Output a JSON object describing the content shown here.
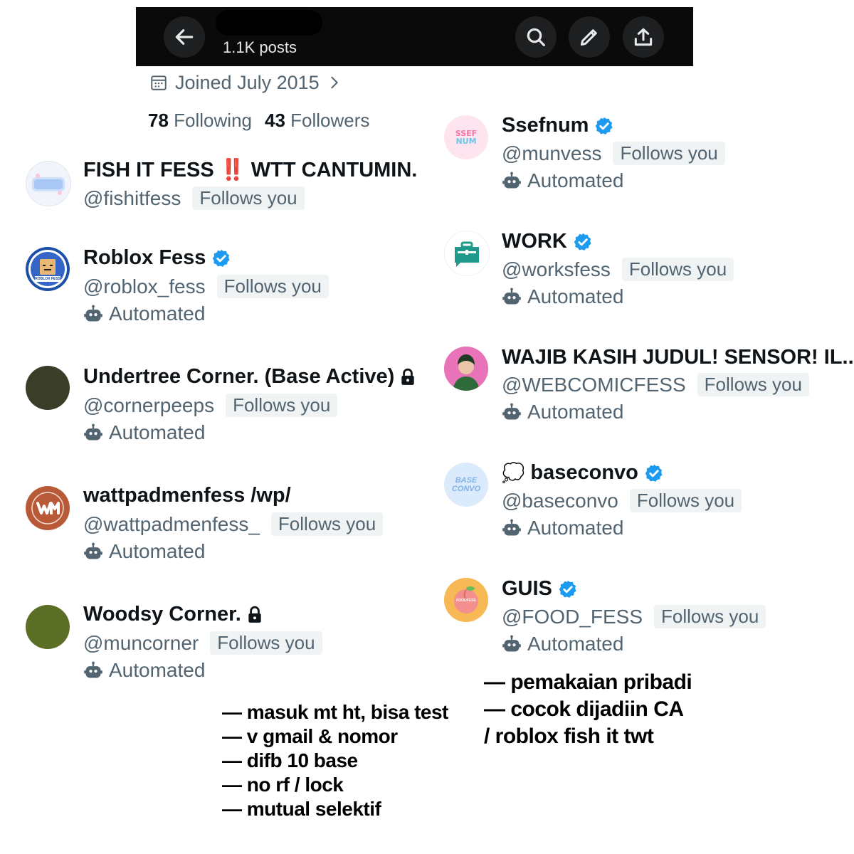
{
  "header": {
    "posts_count": "1.1K posts",
    "icons": [
      "back-arrow-icon",
      "search-icon",
      "edit-pencil-icon",
      "share-upload-icon"
    ]
  },
  "profile": {
    "joined": "Joined July 2015",
    "following_count": "78",
    "following_label": "Following",
    "followers_count": "43",
    "followers_label": "Followers"
  },
  "accounts": [
    {
      "name": "FISH IT FESS",
      "emoji": "‼️",
      "name_suffix": "WTT CANTUMIN.",
      "handle": "@fishitfess",
      "follows_badge": "Follows you"
    },
    {
      "name": "Roblox Fess",
      "handle": "@roblox_fess",
      "follows_badge": "Follows you",
      "automated": "Automated",
      "verified": true
    },
    {
      "name": "Undertree Corner. (Base Active)",
      "handle": "@cornerpeeps",
      "follows_badge": "Follows you",
      "automated": "Automated",
      "locked": true
    },
    {
      "name": "wattpadmenfess /wp/",
      "handle": "@wattpadmenfess_",
      "follows_badge": "Follows you",
      "automated": "Automated"
    },
    {
      "name": "Woodsy Corner.",
      "handle": "@muncorner",
      "follows_badge": "Follows you",
      "automated": "Automated",
      "locked": true
    },
    {
      "name": "Ssefnum",
      "handle": "@munvess",
      "follows_badge": "Follows you",
      "automated": "Automated",
      "verified": true
    },
    {
      "name": "WORK",
      "handle": "@worksfess",
      "follows_badge": "Follows you",
      "automated": "Automated",
      "verified": true
    },
    {
      "name": "WAJIB KASIH JUDUL! SENSOR! IL...",
      "handle": "@WEBCOMICFESS",
      "follows_badge": "Follows you",
      "automated": "Automated"
    },
    {
      "name": "baseconvo",
      "emoji": "💭",
      "handle": "@baseconvo",
      "follows_badge": "Follows you",
      "automated": "Automated",
      "verified": true
    },
    {
      "name": "GUIS",
      "handle": "@FOOD_FESS",
      "follows_badge": "Follows you",
      "automated": "Automated",
      "verified": true
    }
  ],
  "avatar_texts": {
    "roblox": "ROBLOX FESS",
    "ssefnum_1": "SSEF",
    "ssefnum_2": "NUM",
    "baseconvo_1": "BASE",
    "baseconvo_2": "CONVO",
    "food": "FOODFESS"
  },
  "notes_left": [
    "— masuk mt ht, bisa test",
    "— v gmail & nomor",
    "— difb 10 base",
    "— no rf / lock",
    "— mutual selektif"
  ],
  "notes_right": [
    "— pemakaian pribadi",
    "— cocok dijadiin CA",
    "/ roblox fish it twt"
  ],
  "colors": {
    "verified_blue": "#1d9bf0",
    "secondary_text": "#536471",
    "badge_bg": "#eff3f4",
    "header_bg": "#0a0a0a",
    "undertree_avatar": "#3a3d28",
    "woodsy_avatar": "#5a6e26",
    "wattpad_avatar": "#b85a38"
  }
}
